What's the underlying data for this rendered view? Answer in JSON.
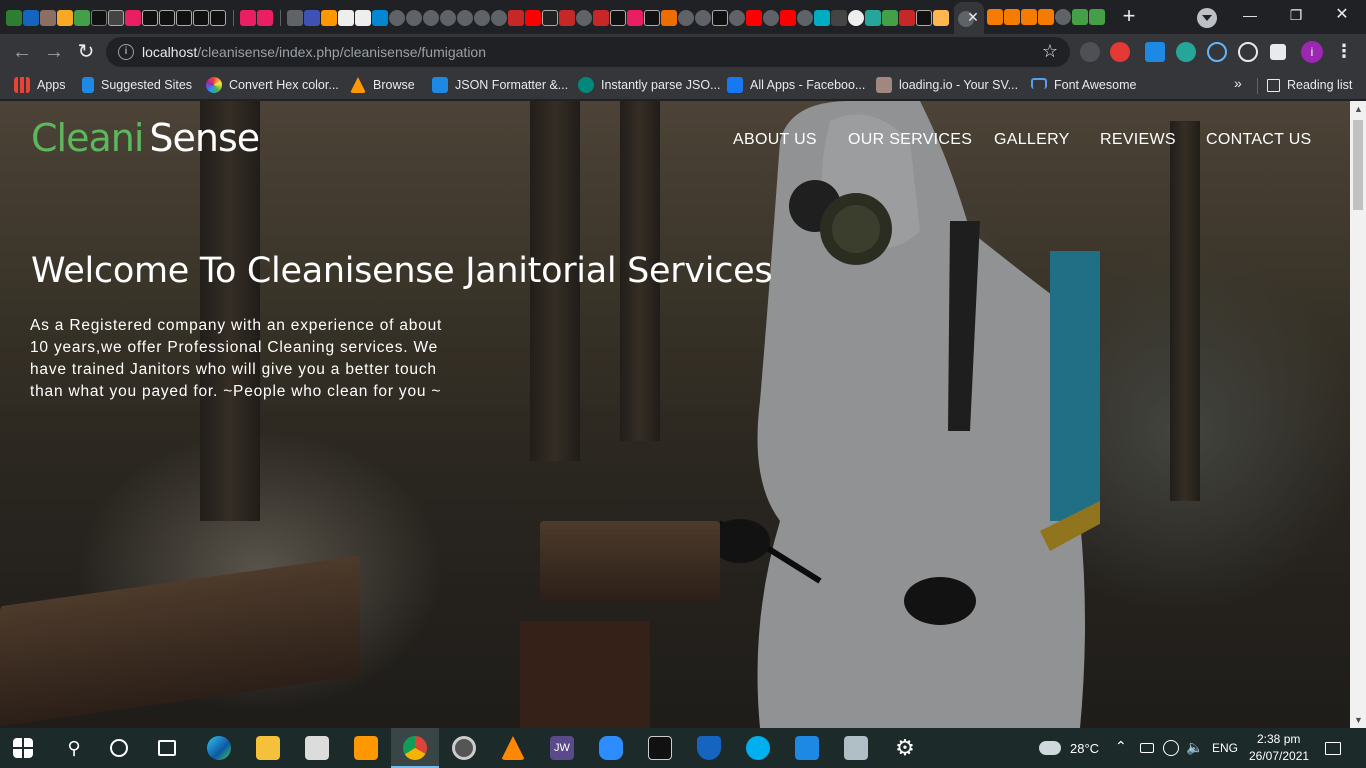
{
  "browser": {
    "url_host": "localhost",
    "url_path": "/cleanisense/index.php/cleanisense/fumigation",
    "bookmarks": [
      {
        "label": "Apps",
        "icon": "apps-grid-icon"
      },
      {
        "label": "Suggested Sites",
        "icon": "bing-icon"
      },
      {
        "label": "Convert Hex color...",
        "icon": "color-wheel-icon"
      },
      {
        "label": "Browse",
        "icon": "browse-icon"
      },
      {
        "label": "JSON Formatter &...",
        "icon": "checkbox-icon"
      },
      {
        "label": "Instantly parse JSO...",
        "icon": "quicktype-icon"
      },
      {
        "label": "All Apps - Faceboo...",
        "icon": "facebook-icon"
      },
      {
        "label": "loading.io - Your SV...",
        "icon": "loading-io-icon"
      },
      {
        "label": "Font Awesome",
        "icon": "flag-icon"
      }
    ],
    "bookmarks_more": "»",
    "reading_list": "Reading list",
    "profile_initial": "i",
    "tab_close": "✕",
    "new_tab": "+"
  },
  "site": {
    "logo_part1": "Cleani",
    "logo_part2": "Sense",
    "nav": [
      "ABOUT US",
      "OUR SERVICES",
      "GALLERY",
      "REVIEWS",
      "CONTACT US"
    ],
    "hero_title": "Welcome To Cleanisense Janitorial Services",
    "hero_text": "As a Registered company with an experience of about 10 years,we offer Professional Cleaning services. We have trained Janitors who will give you a better touch than what you payed for. ~People who clean for you ~"
  },
  "taskbar": {
    "weather_temp": "28°C",
    "language": "ENG",
    "time": "2:38 pm",
    "date": "26/07/2021",
    "apps": [
      "edge-icon",
      "file-explorer-icon",
      "store-icon",
      "sublime-icon",
      "chrome-icon",
      "obs-icon",
      "vlc-icon",
      "jw-icon",
      "zoom-icon",
      "terminal-icon",
      "brave-icon",
      "skype-icon",
      "wps-icon",
      "photos-icon",
      "settings-icon"
    ],
    "jw_label": "JW"
  },
  "colors": {
    "logo_green": "#5cb85c",
    "chrome_dark": "#202124",
    "toolbar": "#35363a",
    "taskbar": "#1c2a2a"
  }
}
